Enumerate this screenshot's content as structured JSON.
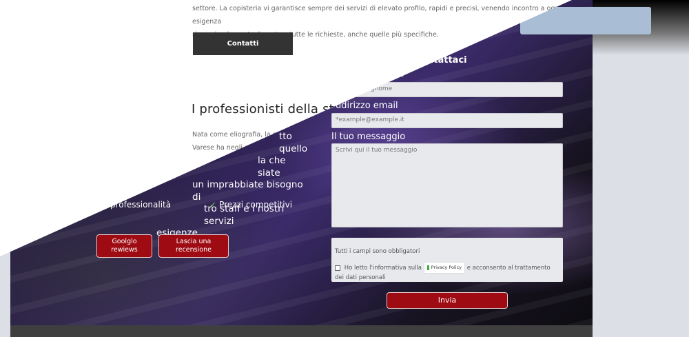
{
  "intro": {
    "line1": "settore. La copisteria vi garantisce sempre dei servizi di elevato profilo, rapidi e precisi, venendo incontro a ogni esigenza",
    "line2": "rispondendo puntualmente a tutte le richieste, anche quelle più specifiche."
  },
  "contatti_label": "Contatti",
  "section_title": "I professionisti della st",
  "nata_text": "Nata come eliografia, la copi",
  "nata_line2": "Varese ha negli ann",
  "big_para": {
    "l1": "tto quello",
    "l2": "la che siate",
    "l3": "un imprabbiate bisogno di",
    "l4": "tro staff e i nostri servizi",
    "l5": "esigenze."
  },
  "features": [
    "professionalità",
    "Prezzi competitivi"
  ],
  "buttons": {
    "google": "Goolglo rewiews",
    "review": "Lascia una recensione",
    "submit": "Invia"
  },
  "form": {
    "title": "ntattaci",
    "name_label_fragment": "ne",
    "name_placeholder": "gnome",
    "email_label": "udirizzo email",
    "email_placeholder": "*example@example.it",
    "message_label": "Il tuo messaggio",
    "message_placeholder": "Scrivi qui il tuo messaggio",
    "required_note": "Tutti i campi sono obbligatori",
    "consent_before": "Ho letto l'informativa sulla",
    "privacy_badge": "Privacy Policy",
    "consent_after": "e acconsento al trattamento",
    "consent_line2": "dei dati personali"
  },
  "colors": {
    "accent_red": "#9e0b13",
    "check_green": "#6fd243",
    "dark_button": "#333333"
  }
}
